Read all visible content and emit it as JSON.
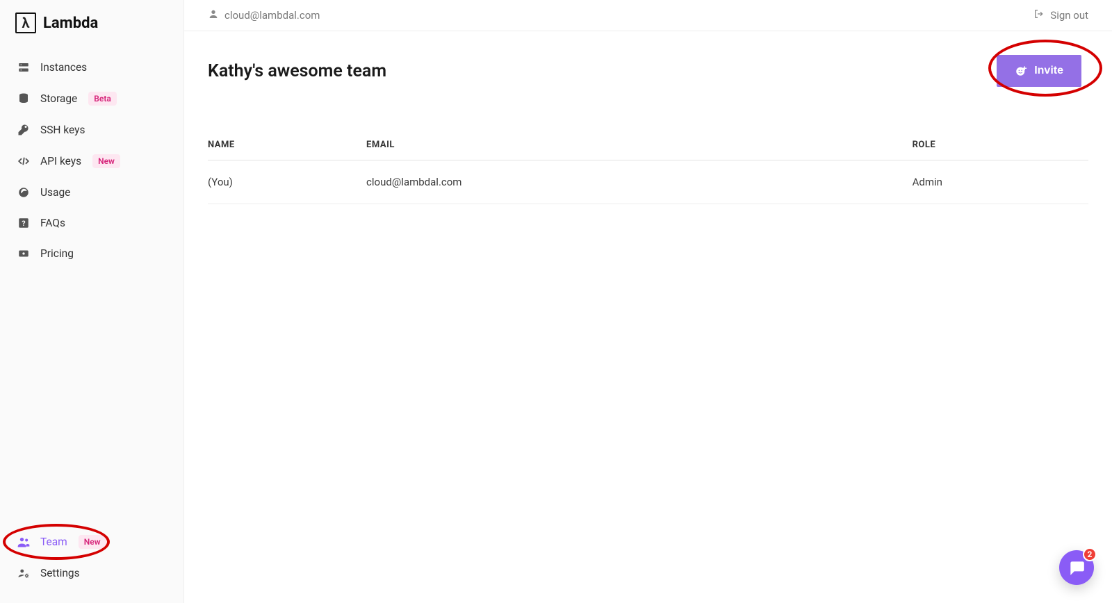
{
  "brand": {
    "name": "Lambda",
    "mark": "λ"
  },
  "header": {
    "user_email": "cloud@lambdal.com",
    "signout_label": "Sign out"
  },
  "sidebar": {
    "top_items": [
      {
        "id": "instances",
        "label": "Instances",
        "icon": "server-icon",
        "badge": null,
        "active": false
      },
      {
        "id": "storage",
        "label": "Storage",
        "icon": "database-icon",
        "badge": "Beta",
        "active": false
      },
      {
        "id": "ssh-keys",
        "label": "SSH keys",
        "icon": "key-icon",
        "badge": null,
        "active": false
      },
      {
        "id": "api-keys",
        "label": "API keys",
        "icon": "code-icon",
        "badge": "New",
        "active": false
      },
      {
        "id": "usage",
        "label": "Usage",
        "icon": "gauge-icon",
        "badge": null,
        "active": false
      },
      {
        "id": "faqs",
        "label": "FAQs",
        "icon": "question-icon",
        "badge": null,
        "active": false
      },
      {
        "id": "pricing",
        "label": "Pricing",
        "icon": "price-icon",
        "badge": null,
        "active": false
      }
    ],
    "bottom_items": [
      {
        "id": "team",
        "label": "Team",
        "icon": "team-icon",
        "badge": "New",
        "active": true
      },
      {
        "id": "settings",
        "label": "Settings",
        "icon": "user-gear-icon",
        "badge": null,
        "active": false
      }
    ]
  },
  "team": {
    "title": "Kathy's awesome team",
    "invite_label": "Invite",
    "columns": {
      "name": "NAME",
      "email": "EMAIL",
      "role": "ROLE"
    },
    "members": [
      {
        "name": "(You)",
        "email": "cloud@lambdal.com",
        "role": "Admin"
      }
    ]
  },
  "chat": {
    "unread": "2"
  },
  "annotations": {
    "invite_circled": true,
    "team_nav_circled": true
  }
}
